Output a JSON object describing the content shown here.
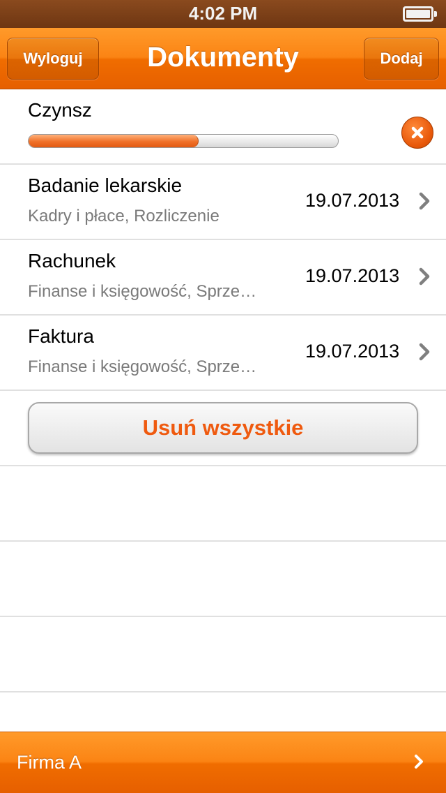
{
  "status_bar": {
    "time": "4:02 PM",
    "battery_level": 1.0
  },
  "nav_bar": {
    "title": "Dokumenty",
    "left_button": "Wyloguj",
    "right_button": "Dodaj"
  },
  "upload": {
    "title": "Czynsz",
    "progress": 0.55,
    "cancel_icon": "cancel-x-icon"
  },
  "documents": [
    {
      "title": "Badanie lekarskie",
      "subtitle": "Kadry i płace, Rozliczenie",
      "date": "19.07.2013"
    },
    {
      "title": "Rachunek",
      "subtitle": "Finanse i księgowość, Sprze…",
      "date": "19.07.2013"
    },
    {
      "title": "Faktura",
      "subtitle": "Finanse i księgowość, Sprze…",
      "date": "19.07.2013"
    }
  ],
  "delete_all": {
    "label": "Usuń wszystkie"
  },
  "bottom_bar": {
    "company": "Firma A"
  },
  "colors": {
    "accent": "#f47a10",
    "delete_text": "#ef5a0f",
    "subtitle_text": "#7a7a7a"
  }
}
